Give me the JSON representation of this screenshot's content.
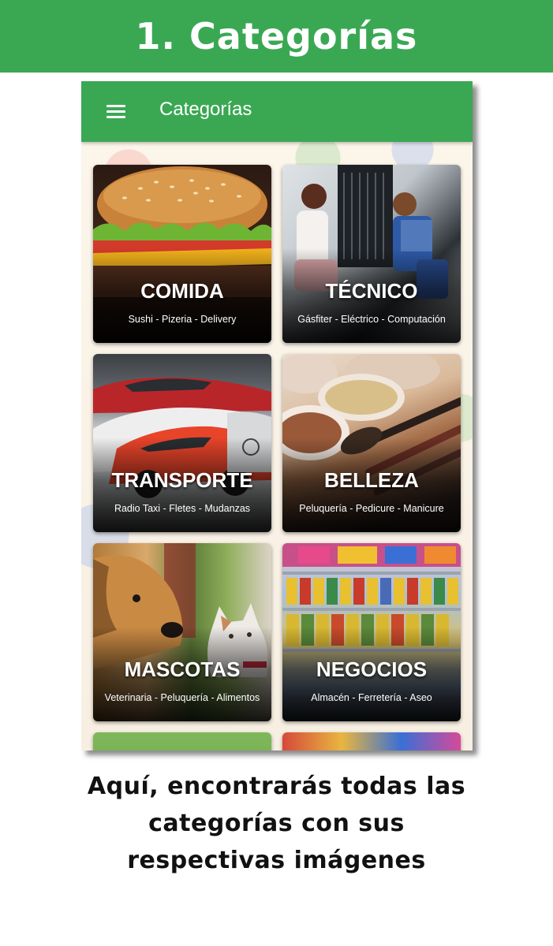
{
  "banner": {
    "title": "1. Categorías"
  },
  "app": {
    "title": "Categorías",
    "menu_icon": "hamburger-menu-icon",
    "accent_color": "#3aa853"
  },
  "categories": [
    {
      "title": "COMIDA",
      "subtitle": "Sushi - Pizeria - Delivery"
    },
    {
      "title": "TÉCNICO",
      "subtitle": "Gásfiter - Eléctrico - Computación"
    },
    {
      "title": "TRANSPORTE",
      "subtitle": "Radio Taxi - Fletes - Mudanzas"
    },
    {
      "title": "BELLEZA",
      "subtitle": "Peluquería - Pedicure - Manicure"
    },
    {
      "title": "MASCOTAS",
      "subtitle": "Veterinaria - Peluquería - Alimentos"
    },
    {
      "title": "NEGOCIOS",
      "subtitle": "Almacén - Ferretería - Aseo"
    }
  ],
  "caption": {
    "line1": "Aquí, encontrarás todas las",
    "line2": "categorías con sus",
    "line3": "respectivas imágenes"
  }
}
